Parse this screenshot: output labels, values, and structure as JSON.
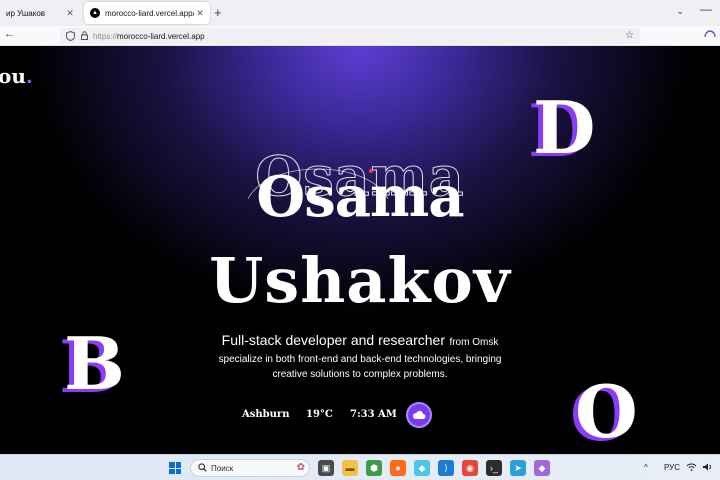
{
  "browser": {
    "tabs": [
      {
        "label": "ир Ушаков",
        "active": false
      },
      {
        "label": "morocco-liard.vercel.app/",
        "active": true
      }
    ],
    "new_tab": "+",
    "tab_list": "⌄",
    "minimize": "—",
    "back": "←",
    "url": {
      "protocol": "https://",
      "host": "morocco-liard.vercel.app"
    },
    "star": "☆"
  },
  "page": {
    "logo": {
      "text": "ou",
      "dot": "."
    },
    "decorative_letters": {
      "d": "D",
      "b": "B",
      "o": "O"
    },
    "name": {
      "first": "Osama",
      "last": "Ushakov"
    },
    "intro": {
      "headline": "Full-stack developer and researcher",
      "from": "from Omsk",
      "line2": "specialize in both front-end and back-end technologies, bringing",
      "line3": "creative solutions to complex problems."
    },
    "weather": {
      "city": "Ashburn",
      "temperature": "19°C",
      "time": "7:33 AM",
      "icon": "cloud-icon"
    }
  },
  "taskbar": {
    "search_placeholder": "Поиск",
    "language": "РУС",
    "caret": "^"
  },
  "colors": {
    "accent": "#8b3df5",
    "weather_button": "#7c3aed",
    "glow": "#5b3fd6"
  }
}
